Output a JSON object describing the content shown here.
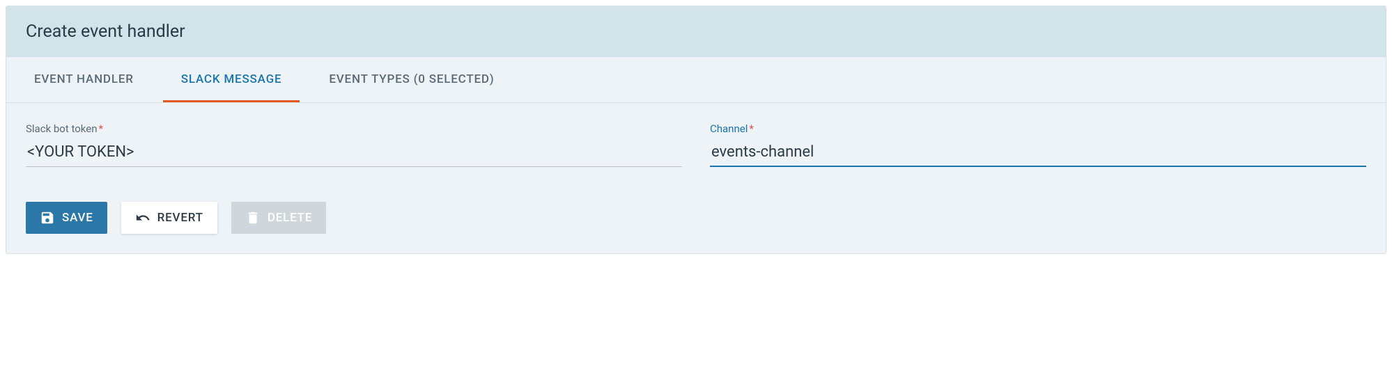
{
  "header": {
    "title": "Create event handler"
  },
  "tabs": [
    {
      "label": "EVENT HANDLER",
      "active": false
    },
    {
      "label": "SLACK MESSAGE",
      "active": true
    },
    {
      "label": "EVENT TYPES (0 SELECTED)",
      "active": false
    }
  ],
  "fields": {
    "slack_token": {
      "label": "Slack bot token",
      "required_mark": "*",
      "value": "<YOUR TOKEN>",
      "focused": false
    },
    "channel": {
      "label": "Channel",
      "required_mark": "*",
      "value": "events-channel",
      "focused": true
    }
  },
  "actions": {
    "save": {
      "label": "SAVE"
    },
    "revert": {
      "label": "REVERT"
    },
    "delete": {
      "label": "DELETE"
    }
  }
}
